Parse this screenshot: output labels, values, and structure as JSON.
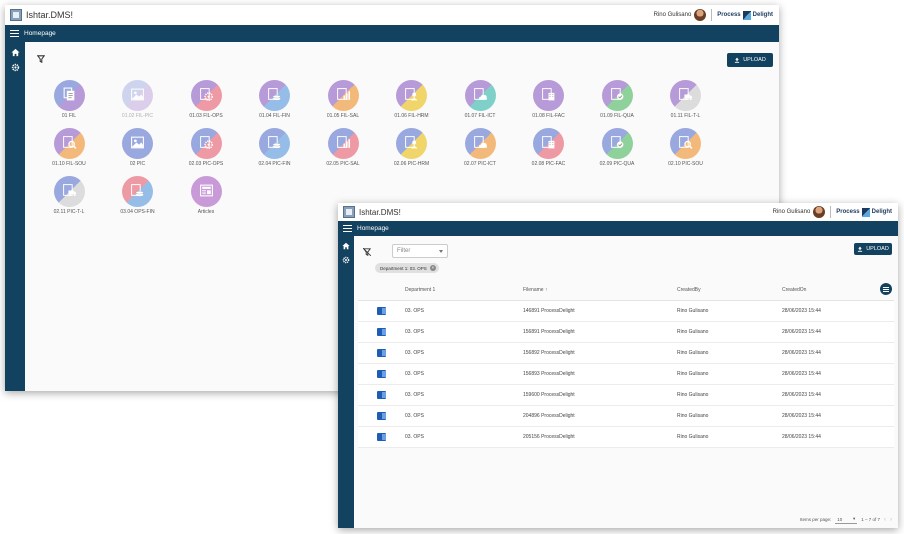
{
  "window1": {
    "app_title": "Ishtar.DMS!",
    "user_name": "Rino Gulisano",
    "brand_left": "Process",
    "brand_right": "Delight",
    "page_title": "Homepage",
    "upload_label": "UPLOAD",
    "tiles": [
      {
        "label": "01 FIL",
        "icon": "files-icon",
        "c1": "#9aa8e0",
        "c2": "#b79ad8",
        "faded": false
      },
      {
        "label": "01.02 FIL-PIC",
        "icon": "image-icon",
        "c1": "#9aa8e0",
        "c2": "#b79ad8",
        "faded": true
      },
      {
        "label": "01.03 FIL-OPS",
        "icon": "gears-icon",
        "c1": "#b79ad8",
        "c2": "#ee9aa4",
        "faded": false
      },
      {
        "label": "01.04 FIL-FIN",
        "icon": "coins-icon",
        "c1": "#b79ad8",
        "c2": "#95bde8",
        "faded": false
      },
      {
        "label": "01.05 FIL-SAL",
        "icon": "chart-icon",
        "c1": "#b79ad8",
        "c2": "#f3b97a",
        "faded": false
      },
      {
        "label": "01.06 FIL-HRM",
        "icon": "person-icon",
        "c1": "#b79ad8",
        "c2": "#f0d66a",
        "faded": false
      },
      {
        "label": "01.07 FIL-ICT",
        "icon": "cloud-icon",
        "c1": "#b79ad8",
        "c2": "#7fd0c8",
        "faded": false
      },
      {
        "label": "01.08 FIL-FAC",
        "icon": "building-icon",
        "c1": "#b79ad8",
        "c2": "#b79ad8",
        "faded": false
      },
      {
        "label": "01.09 FIL-QUA",
        "icon": "check-icon",
        "c1": "#b79ad8",
        "c2": "#8fd19a",
        "faded": false
      },
      {
        "label": "01.11 FIL-T-L",
        "icon": "truck-icon",
        "c1": "#b79ad8",
        "c2": "#dcdcdc",
        "faded": false
      },
      {
        "label": "01.10 FIL-SOU",
        "icon": "search-icon",
        "c1": "#b79ad8",
        "c2": "#f3b97a",
        "faded": false
      },
      {
        "label": "02 PIC",
        "icon": "image-icon",
        "c1": "#9aa8e0",
        "c2": "#9aa8e0",
        "faded": false
      },
      {
        "label": "02.03 PIC-OPS",
        "icon": "gears-icon",
        "c1": "#9aa8e0",
        "c2": "#ee9aa4",
        "faded": false
      },
      {
        "label": "02.04 PIC-FIN",
        "icon": "coins-icon",
        "c1": "#9aa8e0",
        "c2": "#95bde8",
        "faded": false
      },
      {
        "label": "02.05 PIC-SAL",
        "icon": "chart-icon",
        "c1": "#9aa8e0",
        "c2": "#ee9aa4",
        "faded": false
      },
      {
        "label": "02.06 PIC-HRM",
        "icon": "person-icon",
        "c1": "#9aa8e0",
        "c2": "#f0d66a",
        "faded": false
      },
      {
        "label": "02.07 PIC-ICT",
        "icon": "cloud-icon",
        "c1": "#9aa8e0",
        "c2": "#f3b97a",
        "faded": false
      },
      {
        "label": "02.08 PIC-FAC",
        "icon": "building-icon",
        "c1": "#9aa8e0",
        "c2": "#ee9aa4",
        "faded": false
      },
      {
        "label": "02.09 PIC-QUA",
        "icon": "check-icon",
        "c1": "#9aa8e0",
        "c2": "#8fd19a",
        "faded": false
      },
      {
        "label": "02.10 PIC-SOU",
        "icon": "search-icon",
        "c1": "#9aa8e0",
        "c2": "#f3b97a",
        "faded": false
      },
      {
        "label": "02.11 PIC-T-L",
        "icon": "truck-icon",
        "c1": "#9aa8e0",
        "c2": "#dcdcdc",
        "faded": false
      },
      {
        "label": "03.04 OPS-FIN",
        "icon": "coins-icon",
        "c1": "#ee9aa4",
        "c2": "#95bde8",
        "faded": false
      },
      {
        "label": "Articles",
        "icon": "newspaper-icon",
        "c1": "#c99ad8",
        "c2": "#c99ad8",
        "faded": false
      }
    ]
  },
  "window2": {
    "app_title": "Ishtar.DMS!",
    "user_name": "Rino Gulisano",
    "brand_left": "Process",
    "brand_right": "Delight",
    "page_title": "Homepage",
    "upload_label": "UPLOAD",
    "filter_placeholder": "Filter",
    "chip_label": "Department 1: 03. OPS",
    "columns": [
      "",
      "Department 1",
      "Filename ↑",
      "CreatedBy",
      "CreatedOn"
    ],
    "rows": [
      {
        "dept": "03. OPS",
        "file": "146891 ProcessDelight",
        "by": "Rino Gulisano",
        "on": "28/06/2023 15:44"
      },
      {
        "dept": "03. OPS",
        "file": "156891 ProcessDelight",
        "by": "Rino Gulisano",
        "on": "28/06/2023 15:44"
      },
      {
        "dept": "03. OPS",
        "file": "156892 ProcessDelight",
        "by": "Rino Gulisano",
        "on": "28/06/2023 15:44"
      },
      {
        "dept": "03. OPS",
        "file": "156893 ProcessDelight",
        "by": "Rino Gulisano",
        "on": "28/06/2023 15:44"
      },
      {
        "dept": "03. OPS",
        "file": "159600 ProcessDelight",
        "by": "Rino Gulisano",
        "on": "28/06/2023 15:44"
      },
      {
        "dept": "03. OPS",
        "file": "204896 ProcessDelight",
        "by": "Rino Gulisano",
        "on": "28/06/2023 15:44"
      },
      {
        "dept": "03. OPS",
        "file": "205156 ProcessDelight",
        "by": "Rino Gulisano",
        "on": "28/06/2023 15:44"
      }
    ],
    "pager_label": "Items per page:",
    "pager_size": "10",
    "pager_range": "1 – 7 of 7"
  }
}
